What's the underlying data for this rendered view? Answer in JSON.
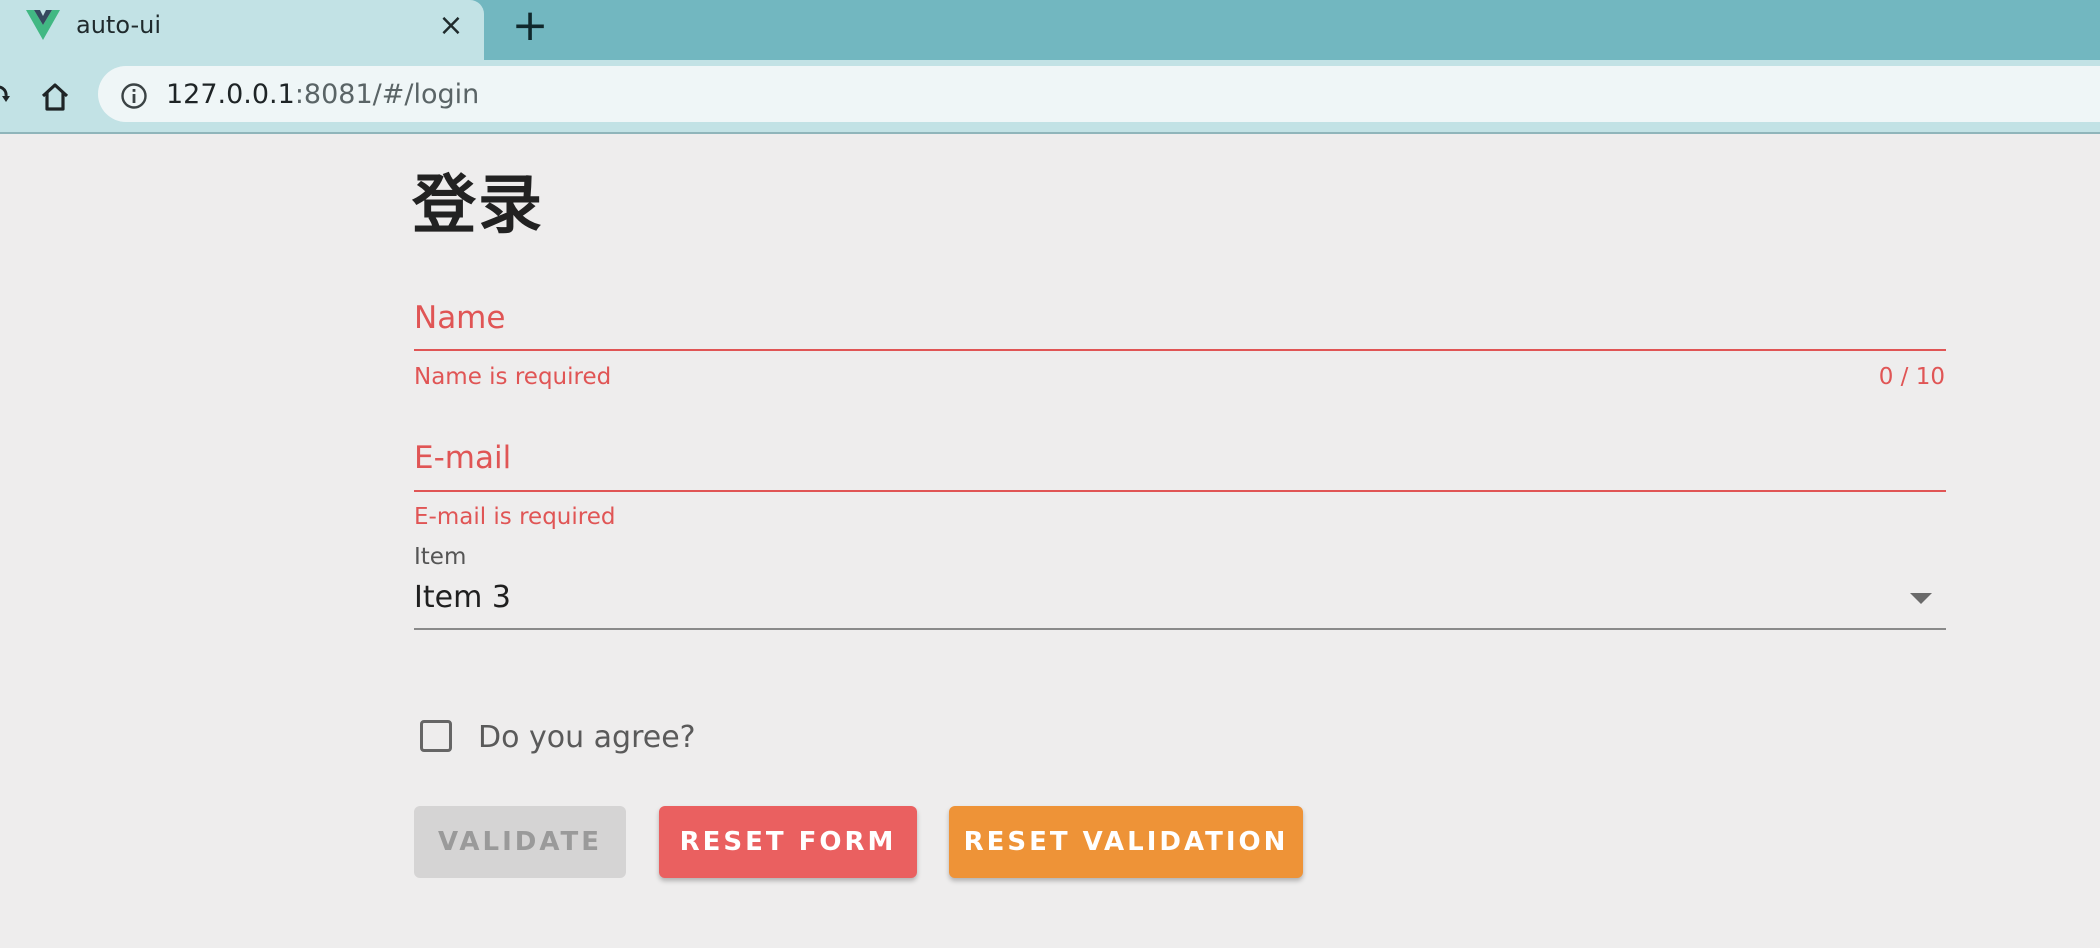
{
  "browser": {
    "tab_title": "auto-ui",
    "url_host": "127.0.0.1",
    "url_rest": ":8081/#/login"
  },
  "page": {
    "title": "登录"
  },
  "form": {
    "name_label": "Name",
    "name_error": "Name is required",
    "name_counter": "0 / 10",
    "email_label": "E-mail",
    "email_error": "E-mail is required",
    "item_label": "Item",
    "item_value": "Item 3",
    "agree_label": "Do you agree?"
  },
  "buttons": {
    "validate": "VALIDATE",
    "reset_form": "RESET FORM",
    "reset_validation": "RESET VALIDATION"
  },
  "colors": {
    "error": "#e05555",
    "reset_form": "#ea6060",
    "reset_validation": "#ee9337",
    "tabstrip": "#72b7c0"
  }
}
